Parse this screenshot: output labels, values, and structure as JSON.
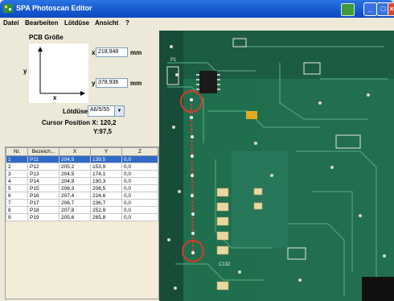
{
  "window": {
    "title": "SPA Photoscan Editor",
    "buttons": {
      "minimize": "_",
      "maximize": "□",
      "close": "×"
    }
  },
  "menu": {
    "items": [
      "Datei",
      "Bearbeiten",
      "Lötdüse",
      "Ansicht",
      "?"
    ]
  },
  "pcb": {
    "label": "PCB Größe",
    "axis_y": "y",
    "axis_x": "x",
    "x_label": "x:",
    "x_value": "218,948",
    "y_label": "y:",
    "y_value": "378,936",
    "unit": "mm"
  },
  "nozzle": {
    "label": "Lötdüse",
    "value": "A6/5/55"
  },
  "cursor": {
    "label": "Cursor Position X: 120,2",
    "y_text": "Y:97,5"
  },
  "table": {
    "headers": [
      "Nr.",
      "Bezeich...",
      "X",
      "Y",
      "Z"
    ],
    "rows": [
      {
        "nr": "1",
        "name": "P11",
        "x": "204,5",
        "y": "139,5",
        "z": "0,0"
      },
      {
        "nr": "2",
        "name": "P12",
        "x": "205,2",
        "y": "153,9",
        "z": "0,0"
      },
      {
        "nr": "3",
        "name": "P13",
        "x": "204,5",
        "y": "174,1",
        "z": "0,0"
      },
      {
        "nr": "4",
        "name": "P14",
        "x": "204,9",
        "y": "190,3",
        "z": "0,0"
      },
      {
        "nr": "5",
        "name": "P15",
        "x": "206,3",
        "y": "206,5",
        "z": "0,0"
      },
      {
        "nr": "6",
        "name": "P16",
        "x": "207,4",
        "y": "224,6",
        "z": "0,0"
      },
      {
        "nr": "7",
        "name": "P17",
        "x": "206,7",
        "y": "236,7",
        "z": "0,0"
      },
      {
        "nr": "8",
        "name": "P18",
        "x": "207,8",
        "y": "252,9",
        "z": "0,0"
      },
      {
        "nr": "9",
        "name": "P19",
        "x": "205,6",
        "y": "265,8",
        "z": "0,0"
      }
    ]
  },
  "board": {
    "labels": {
      "p1": "P1",
      "c132": "C132"
    },
    "colors": {
      "board": "#1f6f4e",
      "marker": "#d93a2b",
      "selection": "#316ac5"
    }
  }
}
